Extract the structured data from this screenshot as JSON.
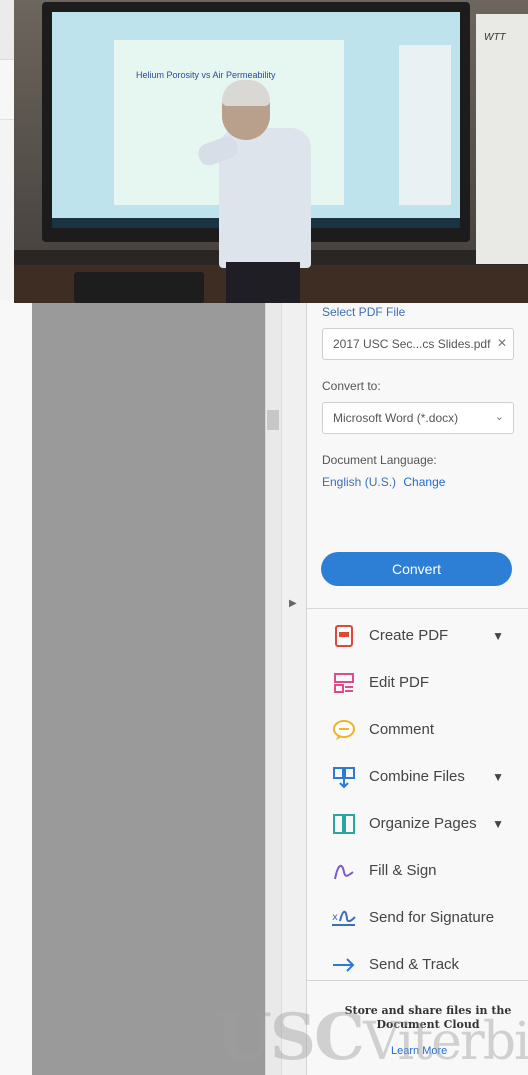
{
  "panel": {
    "select_file_label": "Select PDF File",
    "file_value": "2017 USC Sec...cs Slides.pdf",
    "convert_to_label": "Convert to:",
    "convert_to_value": "Microsoft Word (*.docx)",
    "doc_lang_label": "Document Language:",
    "doc_lang_value": "English (U.S.)",
    "change_link": "Change",
    "convert_button": "Convert"
  },
  "tools": [
    {
      "label": "Create PDF",
      "icon": "create-pdf-icon",
      "expand": true
    },
    {
      "label": "Edit PDF",
      "icon": "edit-pdf-icon",
      "expand": false
    },
    {
      "label": "Comment",
      "icon": "comment-icon",
      "expand": false
    },
    {
      "label": "Combine Files",
      "icon": "combine-files-icon",
      "expand": true
    },
    {
      "label": "Organize Pages",
      "icon": "organize-pages-icon",
      "expand": true
    },
    {
      "label": "Fill & Sign",
      "icon": "fill-sign-icon",
      "expand": false
    },
    {
      "label": "Send for Signature",
      "icon": "send-signature-icon",
      "expand": false
    },
    {
      "label": "Send & Track",
      "icon": "send-track-icon",
      "expand": false
    }
  ],
  "cloud": {
    "text": "Store and share files in the Document Cloud",
    "learn_more": "Learn More"
  },
  "video": {
    "slide_title": "Helium Porosity vs Air Permeability",
    "whiteboard_text": "WTT"
  },
  "watermark": {
    "usc": "USC",
    "viterbi": "Viterbi"
  },
  "colors": {
    "accent": "#2d7fd6",
    "link": "#1f6ad6",
    "doc_gray": "#9a9a9a"
  }
}
